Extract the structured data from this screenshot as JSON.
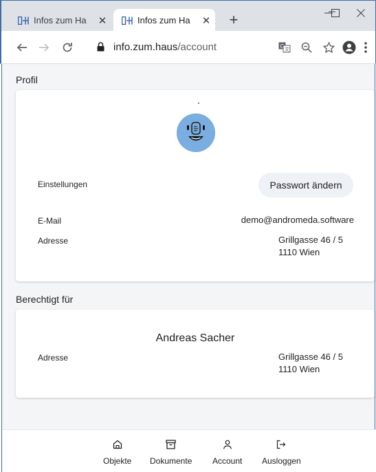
{
  "browser": {
    "tabs": [
      {
        "title": "Infos zum Ha",
        "active": false
      },
      {
        "title": "Infos zum Ha",
        "active": true
      }
    ],
    "url_host": "info.zum.haus",
    "url_path": "/account",
    "window_controls": {
      "minimize": "—",
      "maximize": "☐",
      "close": "✕"
    }
  },
  "profile": {
    "section_title": "Profil",
    "settings_label": "Einstellungen",
    "password_button": "Passwort ändern",
    "email_label": "E-Mail",
    "email_value": "demo@andromeda.software",
    "address_label": "Adresse",
    "address_line1": "Grillgasse 46 / 5",
    "address_line2": "1110 Wien"
  },
  "authorized": {
    "section_title": "Berechtigt für",
    "name": "Andreas Sacher",
    "address_label": "Adresse",
    "address_line1": "Grillgasse 46 / 5",
    "address_line2": "1110 Wien"
  },
  "bottom_nav": {
    "items": [
      {
        "label": "Objekte",
        "icon": "home-icon"
      },
      {
        "label": "Dokumente",
        "icon": "archive-icon"
      },
      {
        "label": "Account",
        "icon": "person-icon"
      },
      {
        "label": "Ausloggen",
        "icon": "logout-icon"
      }
    ]
  },
  "colors": {
    "accent_border": "#3c6ea5",
    "avatar_bg": "#7aaee0",
    "page_bg": "#f4f5f7"
  }
}
